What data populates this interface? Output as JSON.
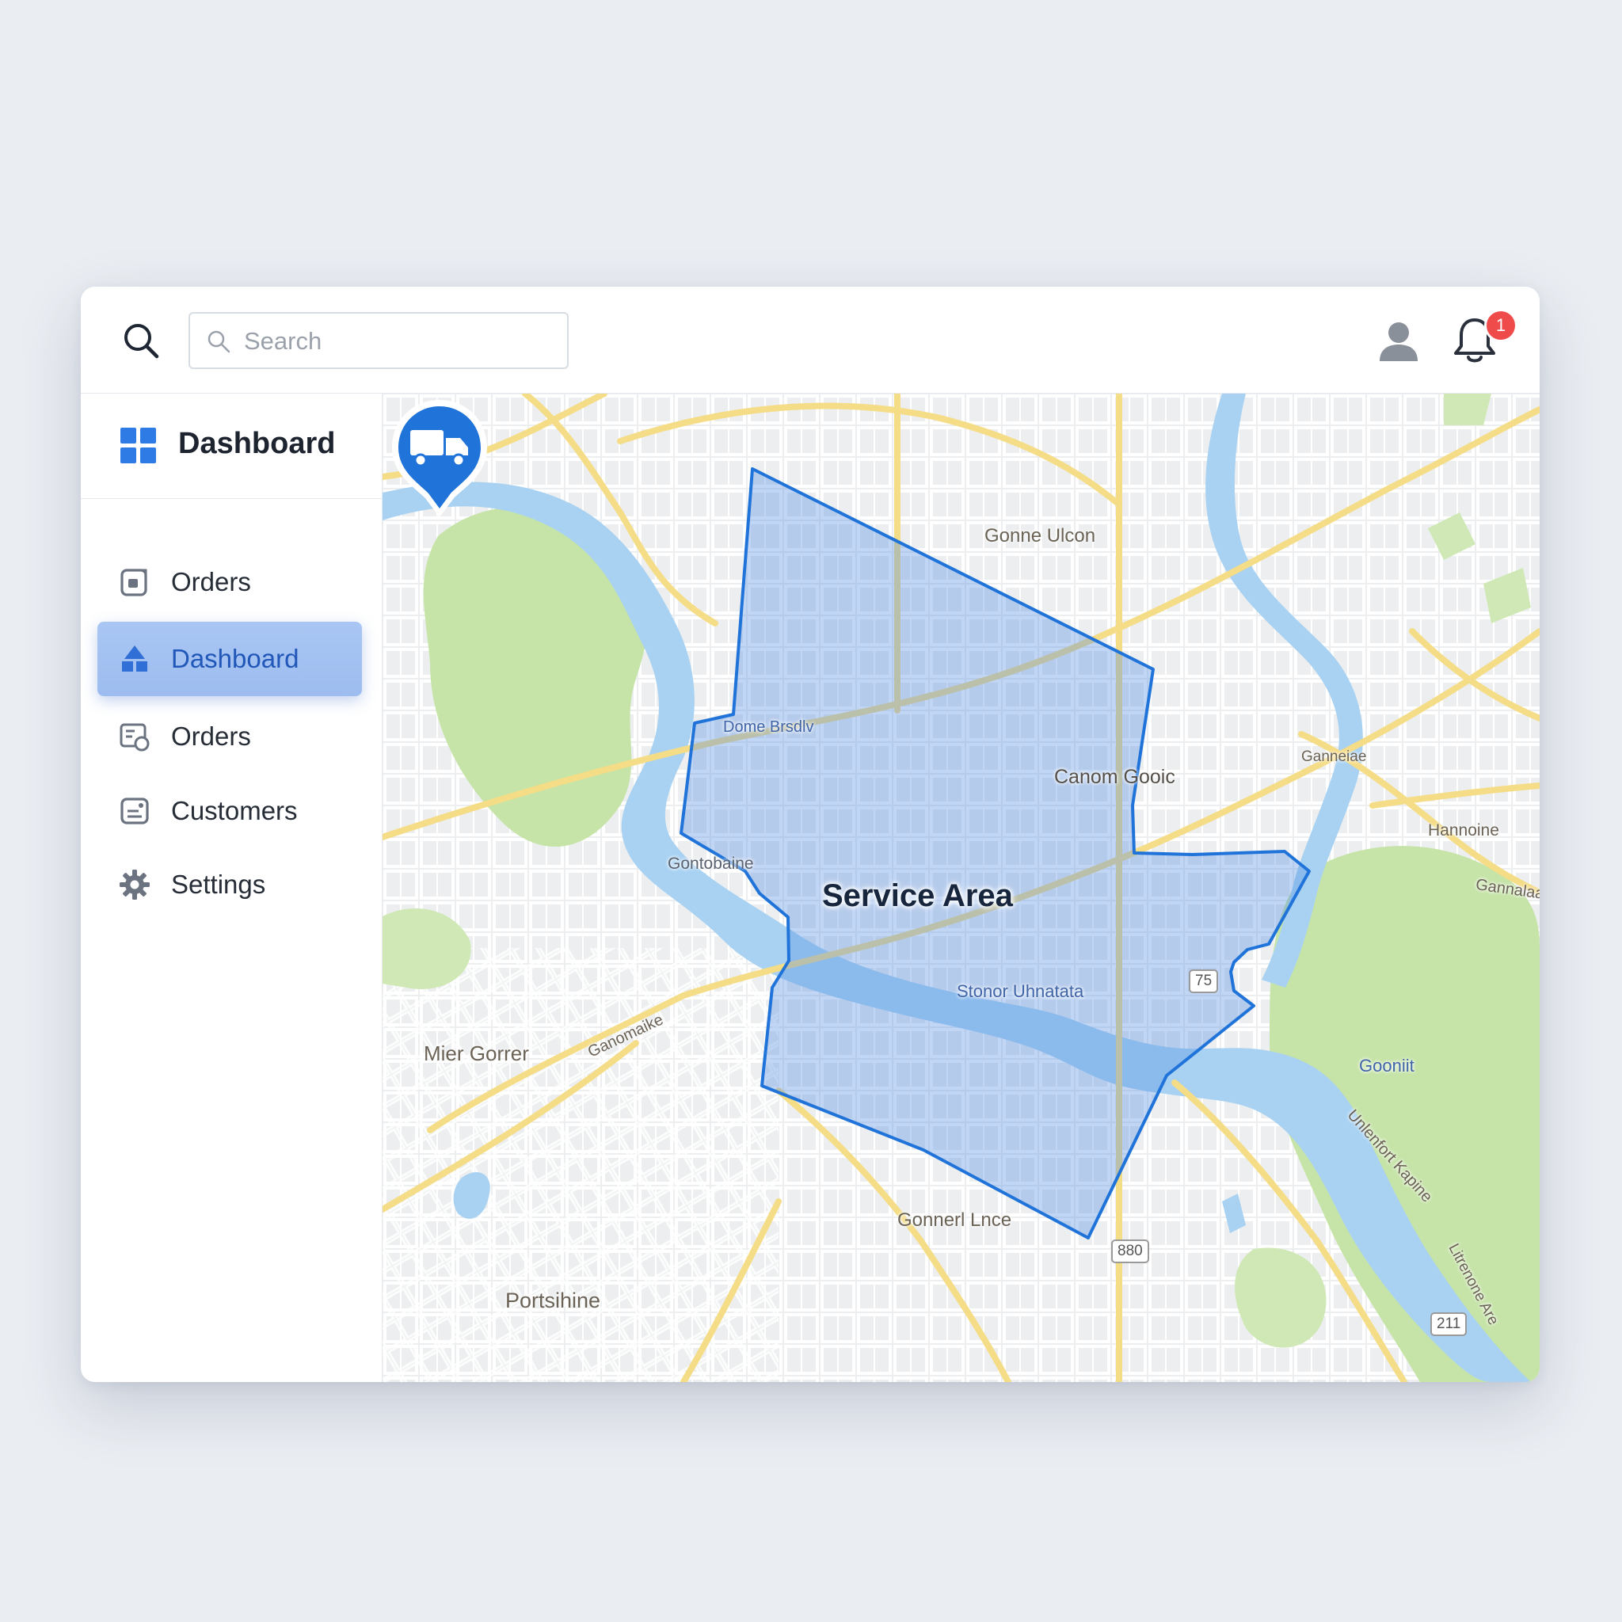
{
  "header": {
    "search": {
      "placeholder": "Search",
      "value": ""
    },
    "notifications": {
      "count": "1"
    }
  },
  "sidebar": {
    "brand_title": "Dashboard",
    "items": [
      {
        "label": "Orders",
        "icon": "orders-icon",
        "active": false
      },
      {
        "label": "Dashboard",
        "icon": "dashboard-icon",
        "active": true
      },
      {
        "label": "Orders",
        "icon": "orders-settings-icon",
        "active": false
      },
      {
        "label": "Customers",
        "icon": "customers-icon",
        "active": false
      },
      {
        "label": "Settings",
        "icon": "gear-icon",
        "active": false
      }
    ]
  },
  "map": {
    "service_area_label": "Service Area",
    "marker_icon": "truck-icon",
    "places": {
      "p1": "Gonne Ulcon",
      "p2": "Mier Gorrer",
      "p3": "Portsihine",
      "p4": "Canom Gooic",
      "p5": "Gooniit",
      "p6": "Hannoine",
      "p7": "Ganneiae",
      "p8": "Gonnerl Lnce",
      "p9": "Ganomaike",
      "p10": "Gannalaa",
      "p11": "Stonor Uhnatata",
      "p12": "Gontobaine",
      "p13": "Dome Brsdlv",
      "p14": "Unlenfort Kapine",
      "p15": "Litrenone Are"
    },
    "shields": {
      "s1": "75",
      "s2": "880",
      "s3": "211"
    },
    "colors": {
      "area_fill": "#5b93e6",
      "area_stroke": "#1f73d9",
      "marker": "#1f73d9",
      "water": "#a9d2f2",
      "park": "#c6e4a8",
      "road_major": "#f5dc86"
    }
  }
}
